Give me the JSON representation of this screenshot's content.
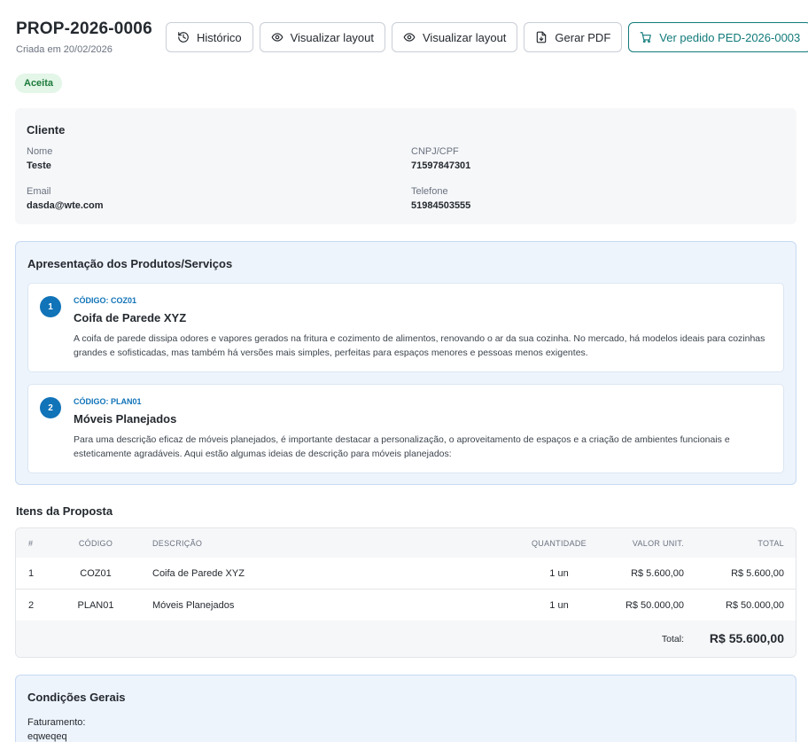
{
  "proposal": {
    "code": "PROP-2026-0006",
    "created": "Criada em 20/02/2026",
    "status": "Aceita"
  },
  "actions": {
    "history": "Histórico",
    "view_layout_1": "Visualizar layout",
    "view_layout_2": "Visualizar layout",
    "pdf": "Gerar PDF",
    "order": "Ver pedido PED-2026-0003"
  },
  "client": {
    "heading": "Cliente",
    "name_label": "Nome",
    "name": "Teste",
    "doc_label": "CNPJ/CPF",
    "doc": "71597847301",
    "email_label": "Email",
    "email": "dasda@wte.com",
    "phone_label": "Telefone",
    "phone": "51984503555"
  },
  "presentation": {
    "heading": "Apresentação dos Produtos/Serviços",
    "products": [
      {
        "num": "1",
        "code": "CÓDIGO: COZ01",
        "name": "Coifa de Parede XYZ",
        "description": "A coifa de parede dissipa odores e vapores gerados na fritura e cozimento de alimentos, renovando o ar da sua cozinha. No mercado, há modelos ideais para cozinhas grandes e sofisticadas, mas também há versões mais simples, perfeitas para espaços menores e pessoas menos exigentes."
      },
      {
        "num": "2",
        "code": "CÓDIGO: PLAN01",
        "name": "Móveis Planejados",
        "description": "Para uma descrição eficaz de móveis planejados, é importante destacar a personalização, o aproveitamento de espaços e a criação de ambientes funcionais e esteticamente agradáveis. Aqui estão algumas ideias de descrição para móveis planejados:"
      }
    ]
  },
  "items": {
    "heading": "Itens da Proposta",
    "columns": [
      "#",
      "CÓDIGO",
      "DESCRIÇÃO",
      "QUANTIDADE",
      "VALOR UNIT.",
      "TOTAL"
    ],
    "rows": [
      {
        "idx": "1",
        "code": "COZ01",
        "desc": "Coifa de Parede XYZ",
        "qty": "1 un",
        "unit": "R$ 5.600,00",
        "total": "R$ 5.600,00"
      },
      {
        "idx": "2",
        "code": "PLAN01",
        "desc": "Móveis Planejados",
        "qty": "1 un",
        "unit": "R$ 50.000,00",
        "total": "R$ 50.000,00"
      }
    ],
    "total_label": "Total:",
    "total_value": "R$ 55.600,00"
  },
  "conditions": {
    "heading": "Condições Gerais",
    "billing_label": "Faturamento:",
    "billing_value": "eqweqeq"
  },
  "colors": {
    "accent": "#127a7a",
    "badge_bg": "#e3f6e8",
    "badge_text": "#1d7a3a",
    "product_number": "#1173b8"
  }
}
